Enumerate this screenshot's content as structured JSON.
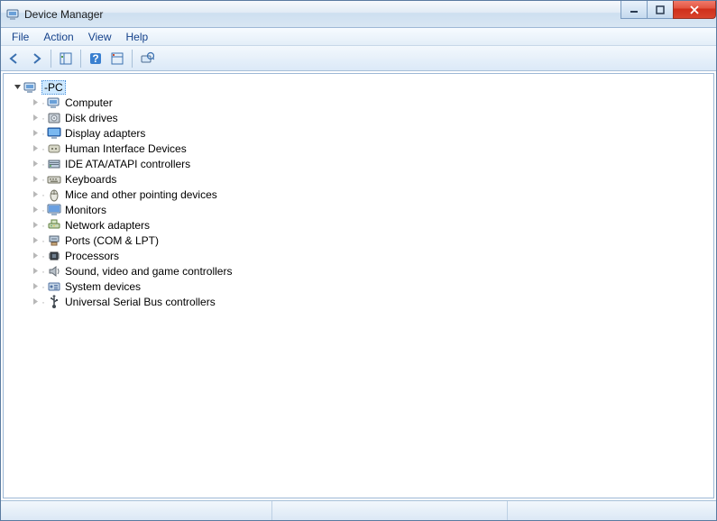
{
  "window": {
    "title": "Device Manager"
  },
  "menu": {
    "items": [
      "File",
      "Action",
      "View",
      "Help"
    ]
  },
  "toolbar": {
    "back": "back-icon",
    "forward": "forward-icon",
    "show_hide": "show-hide-tree-icon",
    "help": "help-icon",
    "properties": "properties-icon",
    "scan": "scan-hardware-icon"
  },
  "tree": {
    "root": {
      "label": "-PC",
      "icon": "computer-root-icon",
      "expanded": true
    },
    "children": [
      {
        "label": "Computer",
        "icon": "computer-icon"
      },
      {
        "label": "Disk drives",
        "icon": "disk-icon"
      },
      {
        "label": "Display adapters",
        "icon": "display-icon"
      },
      {
        "label": "Human Interface Devices",
        "icon": "hid-icon"
      },
      {
        "label": "IDE ATA/ATAPI controllers",
        "icon": "ide-icon"
      },
      {
        "label": "Keyboards",
        "icon": "keyboard-icon"
      },
      {
        "label": "Mice and other pointing devices",
        "icon": "mouse-icon"
      },
      {
        "label": "Monitors",
        "icon": "monitor-icon"
      },
      {
        "label": "Network adapters",
        "icon": "network-icon"
      },
      {
        "label": "Ports (COM & LPT)",
        "icon": "ports-icon"
      },
      {
        "label": "Processors",
        "icon": "processor-icon"
      },
      {
        "label": "Sound, video and game controllers",
        "icon": "sound-icon"
      },
      {
        "label": "System devices",
        "icon": "system-icon"
      },
      {
        "label": "Universal Serial Bus controllers",
        "icon": "usb-icon"
      }
    ]
  }
}
